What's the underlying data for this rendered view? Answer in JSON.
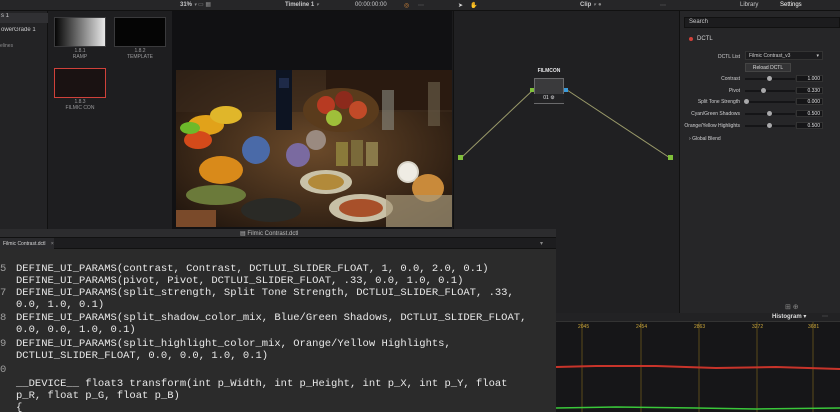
{
  "topbar": {
    "zoom": "31%",
    "timeline": "Timeline 1",
    "timecode": "00:00:00:00",
    "clip": "Clip",
    "library_tab": "Library",
    "settings_tab": "Settings"
  },
  "bins": {
    "items": [
      "s 1",
      "owerGrade 1"
    ],
    "section": "elines"
  },
  "gallery": {
    "stills": [
      {
        "id": "1.8.1",
        "name": "RAMP"
      },
      {
        "id": "1.8.2",
        "name": "TEMPLATE"
      },
      {
        "id": "1.8.3",
        "name": "FILMIC CON"
      }
    ]
  },
  "node": {
    "title": "FILMCON",
    "label": "01"
  },
  "settings": {
    "search_placeholder": "Search",
    "plugin_name": "DCTL",
    "dctl_list_label": "DCTL List",
    "dctl_list_value": "Filmic Contrast_v3",
    "reload_button": "Reload DCTL",
    "params": [
      {
        "label": "Contrast",
        "value": "1.000",
        "level": 0.5
      },
      {
        "label": "Pivot",
        "value": "0.330",
        "level": 0.33
      },
      {
        "label": "Split Tone Strength",
        "value": "0.000",
        "level": 0.0
      },
      {
        "label": "Cyan/Green Shadows",
        "value": "0.500",
        "level": 0.5
      },
      {
        "label": "Orange/Yellow Highlights",
        "value": "0.500",
        "level": 0.5
      }
    ],
    "global_blend": "Global Blend"
  },
  "histogram": {
    "label": "Histogram",
    "ticks": [
      "2045",
      "2454",
      "2863",
      "3272",
      "3681"
    ]
  },
  "editor": {
    "window_title": "Filmic Contrast.dctl",
    "tab": "Filmic Contrast.dctl",
    "lines": [
      {
        "n": "5",
        "text": "DEFINE_UI_PARAMS(contrast, Contrast, DCTLUI_SLIDER_FLOAT, 1, 0.0, 2.0, 0.1)"
      },
      {
        "n": "",
        "text": "DEFINE_UI_PARAMS(pivot, Pivot, DCTLUI_SLIDER_FLOAT, .33, 0.0, 1.0, 0.1)"
      },
      {
        "n": "7",
        "text": "DEFINE_UI_PARAMS(split_strength, Split Tone Strength, DCTLUI_SLIDER_FLOAT, .33,"
      },
      {
        "n": "",
        "text": "0.0, 1.0, 0.1)"
      },
      {
        "n": "8",
        "text": "DEFINE_UI_PARAMS(split_shadow_color_mix, Blue/Green Shadows, DCTLUI_SLIDER_FLOAT,"
      },
      {
        "n": "",
        "text": "0.0, 0.0, 1.0, 0.1)"
      },
      {
        "n": "9",
        "text": "DEFINE_UI_PARAMS(split_highlight_color_mix, Orange/Yellow Highlights,"
      },
      {
        "n": "",
        "text": "DCTLUI_SLIDER_FLOAT, 0.0, 0.0, 1.0, 0.1)"
      },
      {
        "n": "0",
        "text": ""
      },
      {
        "n": "",
        "text": "__DEVICE__ float3 transform(int p_Width, int p_Height, int p_X, int p_Y, float"
      },
      {
        "n": "",
        "text": "p_R, float p_G, float p_B)"
      },
      {
        "n": "",
        "text": "{"
      }
    ]
  }
}
